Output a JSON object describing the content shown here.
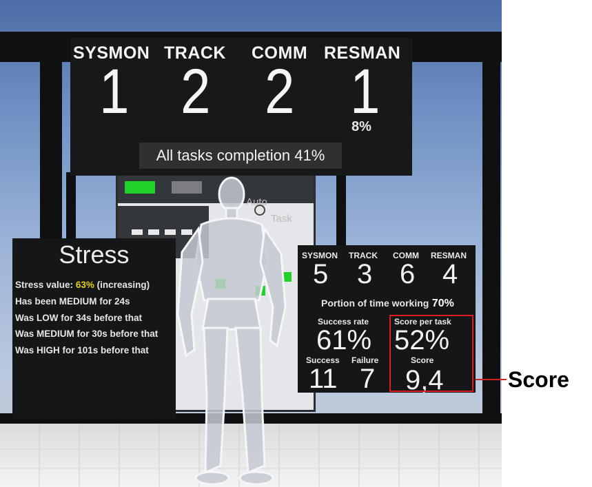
{
  "top_panel": {
    "tasks": [
      {
        "label": "SYSMON",
        "value": "1"
      },
      {
        "label": "TRACK",
        "value": "2"
      },
      {
        "label": "COMM",
        "value": "2"
      },
      {
        "label": "RESMAN",
        "value": "1",
        "sub": "8%"
      }
    ],
    "completion_text": "All tasks completion 41%"
  },
  "monitor": {
    "auto_text": "Auto",
    "task_text": "Task"
  },
  "stress_panel": {
    "title": "Stress",
    "value_prefix": "Stress value:",
    "value": "63%",
    "value_suffix": "(increasing)",
    "lines": [
      "Has been MEDIUM for 24s",
      "Was LOW for 34s before that",
      "Was MEDIUM for 30s before that",
      "Was HIGH for 101s before that"
    ]
  },
  "stats_panel": {
    "tasks": [
      {
        "label": "SYSMON",
        "value": "5"
      },
      {
        "label": "TRACK",
        "value": "3"
      },
      {
        "label": "COMM",
        "value": "6"
      },
      {
        "label": "RESMAN",
        "value": "4"
      }
    ],
    "time_working_label": "Portion of time working",
    "time_working_value": "70%",
    "success_rate_label": "Success rate",
    "success_rate_value": "61%",
    "score_per_task_label": "Score per task",
    "score_per_task_value": "52%",
    "success_label": "Success",
    "success_value": "11",
    "failure_label": "Failure",
    "failure_value": "7",
    "score_label": "Score",
    "score_value": "9,4"
  },
  "callout": {
    "label": "Score",
    "color": "#e01b24"
  },
  "colors": {
    "stress_value": "#e2cf2a",
    "indicator_green": "#21d12a"
  }
}
